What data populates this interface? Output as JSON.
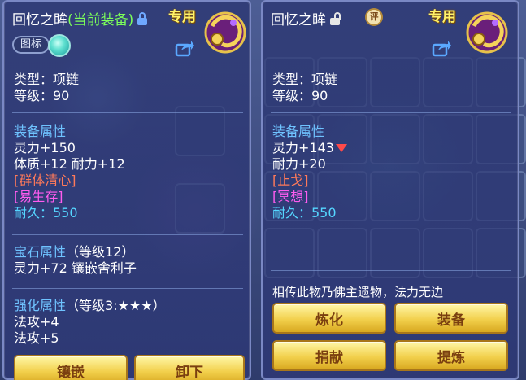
{
  "left_panel": {
    "item_name": "回忆之眸",
    "equipped_note": "(当前装备)",
    "exclusive_label": "专用",
    "tag_label": "图标",
    "type_line": "类型：项链",
    "level_line": "等级：90",
    "equip_attr_header": "装备属性",
    "attr_lines": [
      "灵力+150",
      "体质+12 耐力+12"
    ],
    "special_effect": "[群体清心]",
    "special_skill": "[易生存]",
    "durability_line": "耐久：550",
    "gem_header": "宝石属性",
    "gem_level": "（等级12）",
    "gem_line": "灵力+72 镶嵌舍利子",
    "enhance_header": "强化属性",
    "enhance_level": "（等级3:★★★）",
    "enhance_lines": [
      "法攻+4",
      "法攻+5"
    ],
    "buttons": [
      "镶嵌",
      "卸下"
    ]
  },
  "right_panel": {
    "item_name": "回忆之眸",
    "review_badge": "评",
    "exclusive_label": "专用",
    "type_line": "类型：项链",
    "level_line": "等级：90",
    "equip_attr_header": "装备属性",
    "attr_lines": [
      "灵力+143",
      "耐力+20"
    ],
    "special_effect": "[止戈]",
    "special_skill": "[冥想]",
    "durability_line": "耐久：550",
    "legend": "相传此物乃佛主遗物，法力无边",
    "buttons": [
      "炼化",
      "装备",
      "捐献",
      "提炼"
    ]
  }
}
